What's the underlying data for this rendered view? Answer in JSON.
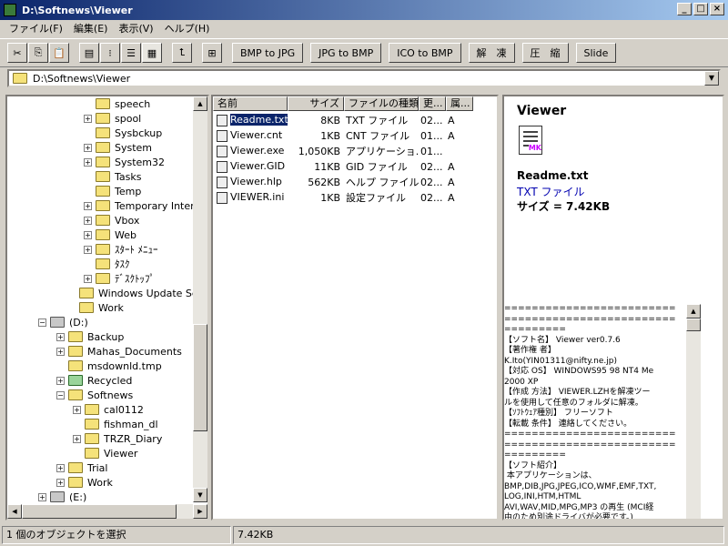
{
  "window": {
    "title": "D:\\Softnews\\Viewer"
  },
  "menu": [
    "ファイル(F)",
    "編集(E)",
    "表示(V)",
    "ヘルプ(H)"
  ],
  "toolbar": {
    "buttons": [
      "BMP to JPG",
      "JPG to BMP",
      "ICO to BMP",
      "解　凍",
      "圧　縮",
      "Slide"
    ]
  },
  "address": {
    "path": "D:\\Softnews\\Viewer"
  },
  "tree": {
    "items": [
      {
        "label": "speech"
      },
      {
        "label": "spool"
      },
      {
        "label": "Sysbckup"
      },
      {
        "label": "System"
      },
      {
        "label": "System32"
      },
      {
        "label": "Tasks"
      },
      {
        "label": "Temp"
      },
      {
        "label": "Temporary Interne"
      },
      {
        "label": "Vbox"
      },
      {
        "label": "Web"
      },
      {
        "label": "ｽﾀｰﾄ ﾒﾆｭｰ"
      },
      {
        "label": "ﾀｽｸ"
      },
      {
        "label": "ﾃﾞｽｸﾄｯﾌﾟ"
      },
      {
        "label": "Windows Update Setu"
      },
      {
        "label": "Work"
      },
      {
        "label": "(D:)"
      },
      {
        "label": "Backup"
      },
      {
        "label": "Mahas_Documents"
      },
      {
        "label": "msdownld.tmp"
      },
      {
        "label": "Recycled"
      },
      {
        "label": "Softnews"
      },
      {
        "label": "cal0112"
      },
      {
        "label": "fishman_dl"
      },
      {
        "label": "TRZR_Diary"
      },
      {
        "label": "Viewer"
      },
      {
        "label": "Trial"
      },
      {
        "label": "Work"
      },
      {
        "label": "(E:)"
      }
    ]
  },
  "files": {
    "columns": [
      "名前",
      "サイズ",
      "ファイルの種類",
      "更...",
      "属..."
    ],
    "rows": [
      {
        "name": "Readme.txt",
        "size": "8KB",
        "type": "TXT ファイル",
        "date": "02...",
        "attr": "A"
      },
      {
        "name": "Viewer.cnt",
        "size": "1KB",
        "type": "CNT ファイル",
        "date": "01...",
        "attr": "A"
      },
      {
        "name": "Viewer.exe",
        "size": "1,050KB",
        "type": "アプリケーショ...",
        "date": "01...",
        "attr": ""
      },
      {
        "name": "Viewer.GID",
        "size": "11KB",
        "type": "GID ファイル",
        "date": "02...",
        "attr": "A"
      },
      {
        "name": "Viewer.hlp",
        "size": "562KB",
        "type": "ヘルプ ファイル",
        "date": "02...",
        "attr": "A"
      },
      {
        "name": "VIEWER.ini",
        "size": "1KB",
        "type": "設定ファイル",
        "date": "02...",
        "attr": "A"
      }
    ]
  },
  "preview": {
    "folder_title": "Viewer",
    "icon_badge": "MK",
    "file_name": "Readme.txt",
    "file_type": "TXT ファイル",
    "file_size": "サイズ = 7.42KB",
    "text": "================================\n================================\n=========\n【ソフト名】 Viewer ver0.7.6\n【著作権 者】\nK.Ito(YIN01311@nifty.ne.jp)\n【対応 OS】 WINDOWS95 98 NT4 Me\n2000 XP\n【作成 方法】 VIEWER.LZHを解凍ツー\nルを使用して任意のフォルダに解凍。\n【ｿﾌﾄｳｪｱ種別】 フリーソフト\n【転載 条件】 連絡してください。\n================================\n================================\n=========\n【ソフト紹介】\n 本アプリケーションは、\nBMP,DIB,JPG,JPEG,ICO,WMF,EMF,TXT,\nLOG,INI,HTM,HTML\nAVI,WAV,MID,MPG,MP3 の再生 (MCI経\n由のため別途ドライバが必要です。)\nおよび Autodesk AutoCAD で作成され"
  },
  "status": {
    "selection": "1 個のオブジェクトを選択",
    "size": "7.42KB"
  }
}
